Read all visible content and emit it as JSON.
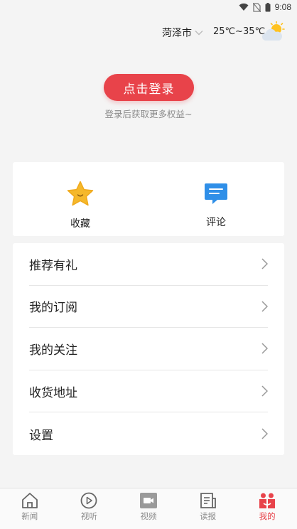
{
  "status_bar": {
    "time": "9:08"
  },
  "header": {
    "city": "菏泽市",
    "temperature": "25℃~35℃",
    "weather_icon": "partly-cloudy-icon"
  },
  "login": {
    "button_label": "点击登录",
    "hint": "登录后获取更多权益~"
  },
  "quick_actions": [
    {
      "label": "收藏",
      "icon": "star-icon"
    },
    {
      "label": "评论",
      "icon": "comment-icon"
    }
  ],
  "menu": [
    {
      "label": "推荐有礼"
    },
    {
      "label": "我的订阅"
    },
    {
      "label": "我的关注"
    },
    {
      "label": "收货地址"
    },
    {
      "label": "设置"
    }
  ],
  "tabs": [
    {
      "label": "新闻",
      "icon": "home-icon"
    },
    {
      "label": "视听",
      "icon": "play-icon"
    },
    {
      "label": "视频",
      "icon": "video-camera-icon"
    },
    {
      "label": "读报",
      "icon": "newspaper-icon"
    },
    {
      "label": "我的",
      "icon": "profile-icon",
      "active": true
    }
  ],
  "colors": {
    "accent": "#e8434a",
    "background": "#f4f4f4",
    "star": "#f5b82b",
    "comment": "#2f8fe8"
  }
}
